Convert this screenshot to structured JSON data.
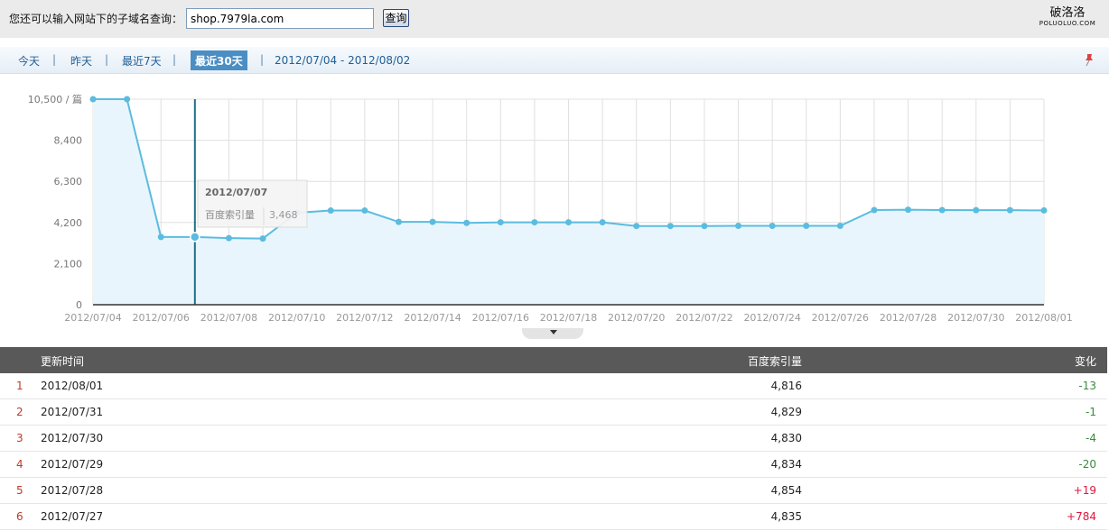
{
  "query": {
    "label": "您还可以输入网站下的子域名查询：",
    "input_value": "shop.7979la.com",
    "button_label": "查询"
  },
  "brand": {
    "name": "破洛洛",
    "domain": "POLUOLUO.COM"
  },
  "ranges": {
    "tabs": [
      "今天",
      "昨天",
      "最近7天",
      "最近30天"
    ],
    "active_index": 3,
    "separator": "|",
    "date_range": "2012/07/04 - 2012/08/02"
  },
  "chart_data": {
    "type": "area",
    "x": [
      "2012/07/04",
      "2012/07/05",
      "2012/07/06",
      "2012/07/07",
      "2012/07/08",
      "2012/07/09",
      "2012/07/10",
      "2012/07/11",
      "2012/07/12",
      "2012/07/13",
      "2012/07/14",
      "2012/07/15",
      "2012/07/16",
      "2012/07/17",
      "2012/07/18",
      "2012/07/19",
      "2012/07/20",
      "2012/07/21",
      "2012/07/22",
      "2012/07/23",
      "2012/07/24",
      "2012/07/25",
      "2012/07/26",
      "2012/07/27",
      "2012/07/28",
      "2012/07/29",
      "2012/07/30",
      "2012/07/31",
      "2012/08/01"
    ],
    "series": [
      {
        "values": [
          10500,
          10500,
          3460,
          3460,
          3400,
          3380,
          4700,
          4810,
          4810,
          4230,
          4230,
          4180,
          4210,
          4210,
          4210,
          4210,
          4020,
          4020,
          4020,
          4030,
          4030,
          4030,
          4030,
          4835,
          4854,
          4834,
          4830,
          4829,
          4816
        ]
      }
    ],
    "x_tick_labels": [
      "2012/07/04",
      "2012/07/06",
      "2012/07/08",
      "2012/07/10",
      "2012/07/12",
      "2012/07/14",
      "2012/07/16",
      "2012/07/18",
      "2012/07/20",
      "2012/07/22",
      "2012/07/24",
      "2012/07/26",
      "2012/07/28",
      "2012/07/30",
      "2012/08/01"
    ],
    "y_tick_labels": [
      "10,500 / 篇",
      "8,400",
      "6,300",
      "4,200",
      "2,100",
      "0"
    ],
    "y_ticks": [
      10500,
      8400,
      6300,
      4200,
      2100,
      0
    ],
    "ylim": [
      0,
      10500
    ],
    "grid": true,
    "highlight_index": 3,
    "tooltip": {
      "date": "2012/07/07",
      "label": "百度索引量",
      "value": "3,468"
    },
    "colors": {
      "line": "#5bbcdf",
      "fill": "#e9f5fc",
      "cursor": "#1f6f86"
    }
  },
  "table": {
    "headers": {
      "date": "更新时间",
      "value": "百度索引量",
      "change": "变化"
    },
    "rows": [
      {
        "idx": "1",
        "date": "2012/08/01",
        "value": "4,816",
        "change": "-13"
      },
      {
        "idx": "2",
        "date": "2012/07/31",
        "value": "4,829",
        "change": "-1"
      },
      {
        "idx": "3",
        "date": "2012/07/30",
        "value": "4,830",
        "change": "-4"
      },
      {
        "idx": "4",
        "date": "2012/07/29",
        "value": "4,834",
        "change": "-20"
      },
      {
        "idx": "5",
        "date": "2012/07/28",
        "value": "4,854",
        "change": "+19"
      },
      {
        "idx": "6",
        "date": "2012/07/27",
        "value": "4,835",
        "change": "+784"
      }
    ]
  }
}
